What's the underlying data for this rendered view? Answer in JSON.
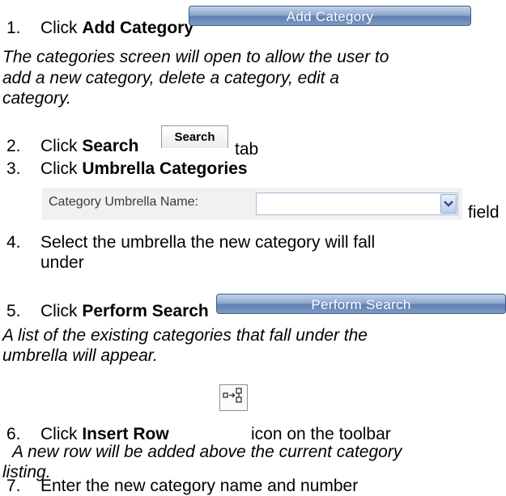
{
  "steps": [
    {
      "num": "1.",
      "prefix": "Click ",
      "bold": "Add Category",
      "suffix": ""
    },
    {
      "num": "2.",
      "prefix": "Click ",
      "bold": "Search",
      "suffix": "tab"
    },
    {
      "num": "3.",
      "prefix": "Click ",
      "bold": "Umbrella Categories",
      "suffix": "field"
    },
    {
      "num": "4.",
      "line1": "Select the umbrella the new category will fall",
      "line2": "under"
    },
    {
      "num": "5.",
      "prefix": "Click ",
      "bold": "Perform Search",
      "suffix": ""
    },
    {
      "num": "6.",
      "prefix": "Click ",
      "bold": "Insert Row",
      "suffix": "icon on the toolbar"
    },
    {
      "num": "7.",
      "text": "Enter the new category name and number"
    }
  ],
  "notes": {
    "add_category": [
      "The categories screen will open to allow the user to",
      "add a new category, delete a category, edit a",
      "category."
    ],
    "perform_search": [
      "A list of the existing categories that fall under the",
      "umbrella will appear."
    ],
    "insert_row": [
      "A new row will be added above the current category",
      "listing."
    ]
  },
  "ui": {
    "add_category_button": "Add Category",
    "search_tab": "Search",
    "umbrella_field_label": "Category Umbrella Name:",
    "umbrella_field_value": "",
    "perform_search_button": "Perform Search",
    "insert_row_icon": "insert-row-icon"
  },
  "colors": {
    "button_blue": "#6f8cbc",
    "field_border": "#a7b8d6"
  }
}
